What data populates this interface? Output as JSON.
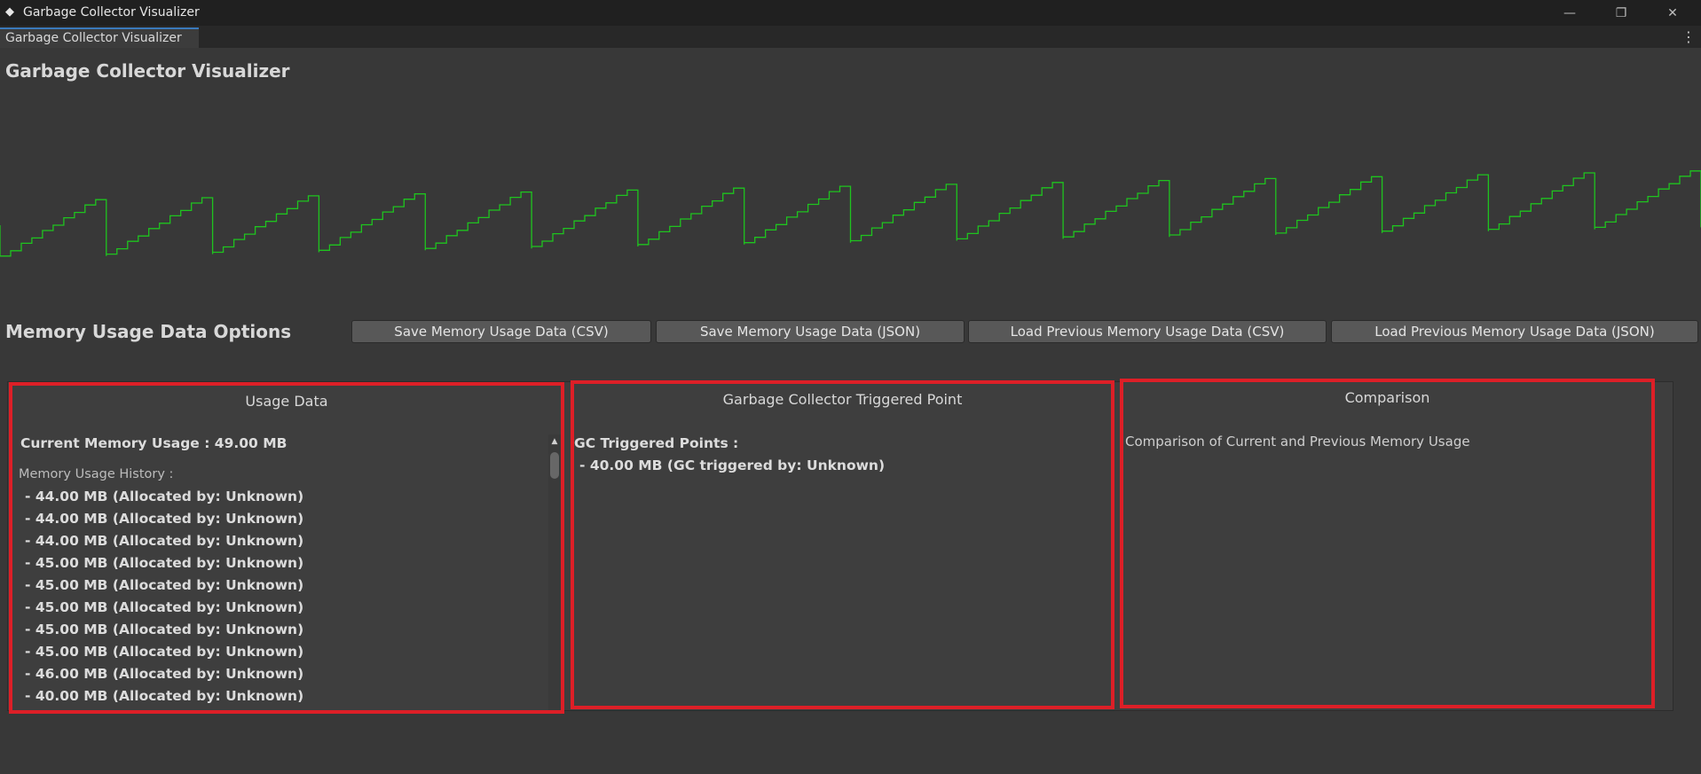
{
  "window": {
    "title": "Garbage Collector Visualizer",
    "minimize_glyph": "—",
    "restore_glyph": "❐",
    "close_glyph": "✕"
  },
  "tab": {
    "label": "Garbage Collector Visualizer",
    "menu_glyph": "⋮"
  },
  "page": {
    "title": "Garbage Collector Visualizer"
  },
  "graph": {
    "line_color": "#1ec41e",
    "background": "#383838",
    "y_range_mb": [
      35,
      55
    ],
    "baseline_mb": 40,
    "samples_per_cycle": 10,
    "cycles": 16
  },
  "options": {
    "title": "Memory Usage Data Options",
    "buttons": {
      "save_csv": "Save Memory Usage Data (CSV)",
      "save_json": "Save Memory Usage Data (JSON)",
      "load_csv": "Load Previous Memory Usage Data (CSV)",
      "load_json": "Load Previous Memory Usage Data (JSON)"
    }
  },
  "panels": {
    "highlight_color": "#dd1f27",
    "usage": {
      "title": "Usage Data",
      "current": "Current Memory Usage : 49.00 MB",
      "history_label": "Memory Usage History :",
      "history": [
        "- 44.00 MB (Allocated by: Unknown)",
        "- 44.00 MB (Allocated by: Unknown)",
        "- 44.00 MB (Allocated by: Unknown)",
        "- 45.00 MB (Allocated by: Unknown)",
        "- 45.00 MB (Allocated by: Unknown)",
        "- 45.00 MB (Allocated by: Unknown)",
        "- 45.00 MB (Allocated by: Unknown)",
        "- 45.00 MB (Allocated by: Unknown)",
        "- 46.00 MB (Allocated by: Unknown)",
        "- 40.00 MB (Allocated by: Unknown)"
      ],
      "scroll_up_glyph": "▲"
    },
    "gc": {
      "title": "Garbage Collector Triggered Point",
      "label": "GC Triggered Points :",
      "points": [
        "- 40.00 MB (GC triggered by: Unknown)"
      ]
    },
    "comparison": {
      "title": "Comparison",
      "text": "Comparison of Current and Previous Memory Usage"
    }
  }
}
